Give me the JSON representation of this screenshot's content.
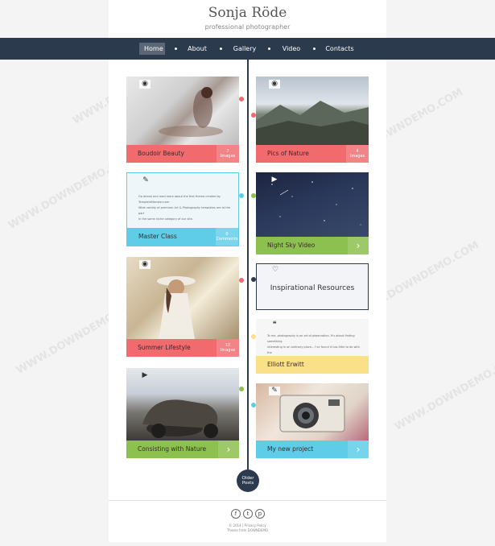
{
  "header": {
    "title": "Sonja Röde",
    "subtitle": "professional photographer"
  },
  "nav": {
    "items": [
      "Home",
      "About",
      "Gallery",
      "Video",
      "Contacts"
    ],
    "active": "Home"
  },
  "posts": {
    "boudoir": {
      "title": "Boudoir Beauty",
      "count": "7",
      "unit": "Images",
      "icon": "camera-icon"
    },
    "nature": {
      "title": "Pics of Nature",
      "count": "4",
      "unit": "Images",
      "icon": "camera-icon"
    },
    "master": {
      "title": "Master Class",
      "count": "0",
      "unit": "Comments",
      "icon": "pencil-icon",
      "text": [
        "Go ahead and read more about the first theme created by TemplateMonster.com",
        "Wide variety of premium Art & Photography templates are at the part",
        "In the same niche category of our site."
      ]
    },
    "nightsky": {
      "title": "Night Sky Video",
      "icon": "video-icon"
    },
    "inspirational": {
      "title": "Inspirational Resources",
      "icon": "heart-icon"
    },
    "summer": {
      "title": "Summer Lifestyle",
      "count": "10",
      "unit": "Images",
      "icon": "camera-icon"
    },
    "quote": {
      "author": "Elliott Erwitt",
      "icon": "quote-icon",
      "text": [
        "To me, photography is an art of observation. It's about finding something",
        "interesting in an ordinary place... I've found it has little to do with the",
        "things you see and everything to do with the way you see them."
      ]
    },
    "consisting": {
      "title": "Consisting with Nature",
      "icon": "video-icon"
    },
    "project": {
      "title": "My new project",
      "icon": "pencil-icon"
    }
  },
  "older_posts": {
    "line1": "Older",
    "line2": "Posts"
  },
  "footer": {
    "social": [
      "f",
      "t",
      "p"
    ],
    "copyright": "© 2014 | Privacy Policy",
    "credit": "Theme from DOWNDEMO"
  },
  "watermark": "WWW.DOWNDEMO.COM",
  "colors": {
    "nav": "#2c3a4e",
    "pink": "#f06a6e",
    "blue": "#5fcde8",
    "green": "#8cc04f",
    "yellow": "#fbe08a"
  }
}
